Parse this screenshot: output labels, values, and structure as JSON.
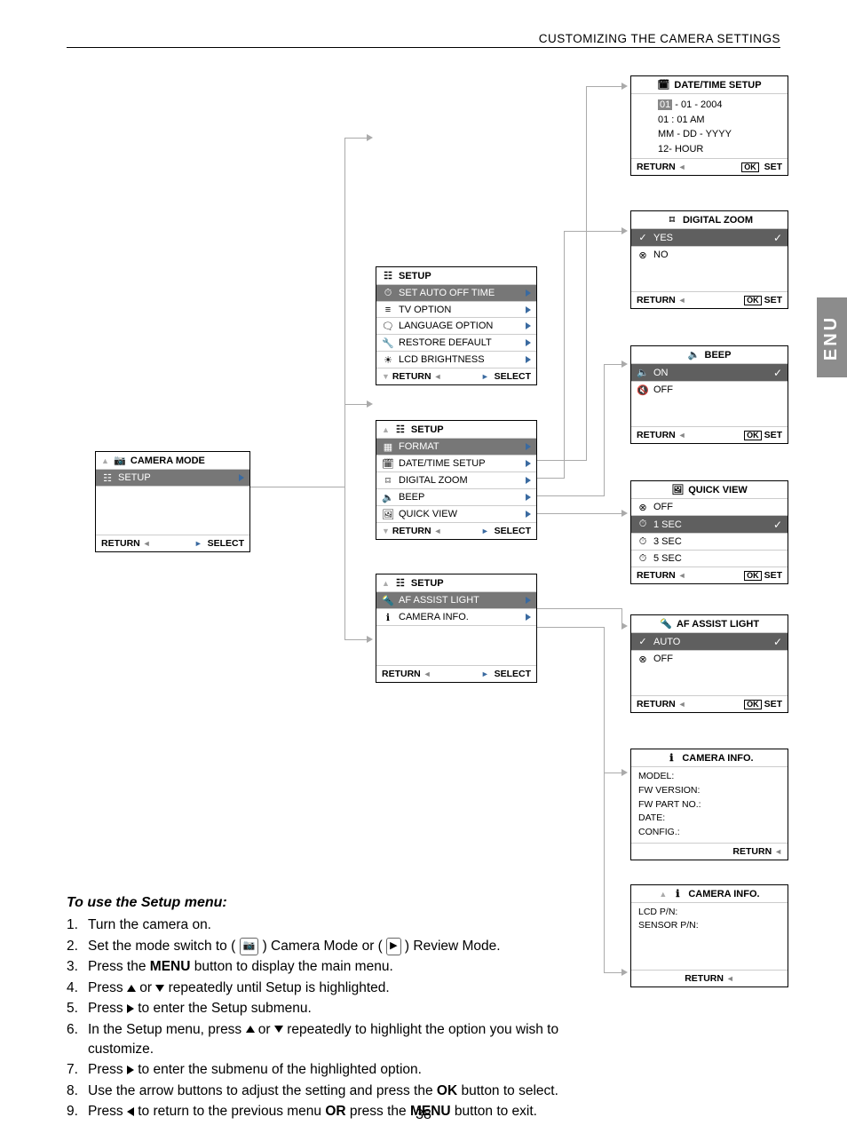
{
  "header": "CUSTOMIZING THE CAMERA SETTINGS",
  "side_tab": "ENU",
  "page_number": "38",
  "camera_mode_menu": {
    "title": "CAMERA MODE",
    "item": "SETUP",
    "footer_return": "RETURN",
    "footer_select": "SELECT"
  },
  "setup1": {
    "title": "SETUP",
    "items": [
      "SET AUTO OFF TIME",
      "TV OPTION",
      "LANGUAGE OPTION",
      "RESTORE DEFAULT",
      "LCD BRIGHTNESS"
    ],
    "footer_return": "RETURN",
    "footer_select": "SELECT"
  },
  "setup2": {
    "title": "SETUP",
    "items": [
      "FORMAT",
      "DATE/TIME SETUP",
      "DIGITAL ZOOM",
      "BEEP",
      "QUICK VIEW"
    ],
    "footer_return": "RETURN",
    "footer_select": "SELECT"
  },
  "setup3": {
    "title": "SETUP",
    "items": [
      "AF ASSIST LIGHT",
      "CAMERA INFO."
    ],
    "footer_return": "RETURN",
    "footer_select": "SELECT"
  },
  "datetime": {
    "title": "DATE/TIME SETUP",
    "lines": [
      "01 - 01 - 2004",
      "01 : 01 AM",
      "MM - DD - YYYY",
      "12- HOUR"
    ],
    "footer_return": "RETURN",
    "footer_set": "SET"
  },
  "digital_zoom": {
    "title": "DIGITAL  ZOOM",
    "yes": "YES",
    "no": "NO",
    "footer_return": "RETURN",
    "footer_set": "SET"
  },
  "beep": {
    "title": "BEEP",
    "on": "ON",
    "off": "OFF",
    "footer_return": "RETURN",
    "footer_set": "SET"
  },
  "quick_view": {
    "title": "QUICK VIEW",
    "items": [
      "OFF",
      "1 SEC",
      "3 SEC",
      "5 SEC"
    ],
    "footer_return": "RETURN",
    "footer_set": "SET"
  },
  "af_assist": {
    "title": "AF ASSIST LIGHT",
    "auto": "AUTO",
    "off": "OFF",
    "footer_return": "RETURN",
    "footer_set": "SET"
  },
  "camera_info1": {
    "title": "CAMERA  INFO.",
    "lines": [
      "MODEL:",
      "FW VERSION:",
      "FW PART NO.:",
      "DATE:",
      "CONFIG.:"
    ],
    "footer_return": "RETURN"
  },
  "camera_info2": {
    "title": "CAMERA  INFO.",
    "lines": [
      "LCD P/N:",
      "SENSOR P/N:"
    ],
    "footer_return": "RETURN"
  },
  "instructions": {
    "title": "To use  the Setup menu:",
    "s1": "Turn the camera on.",
    "s2a": "Set the mode switch to ( ",
    "s2b": " ) Camera Mode or ( ",
    "s2c": " ) Review Mode.",
    "s3a": "Press the ",
    "s3b": "MENU",
    "s3c": " button to display the main menu.",
    "s4a": "Press ",
    "s4b": "  or  ",
    "s4c": " repeatedly until Setup is highlighted.",
    "s5a": "Press ",
    "s5b": " to enter the Setup submenu.",
    "s6a": "In the Setup menu, press ",
    "s6b": " or ",
    "s6c": " repeatedly to highlight the option you wish to customize.",
    "s7a": "Press ",
    "s7b": " to enter the submenu of the highlighted option.",
    "s8a": "Use the arrow buttons to adjust the setting and press the ",
    "s8b": "OK",
    "s8c": " button to select.",
    "s9a": "Press ",
    "s9b": " to return to the previous menu ",
    "s9c": "OR",
    "s9d": " press the ",
    "s9e": "MENU",
    "s9f": " button to exit."
  }
}
